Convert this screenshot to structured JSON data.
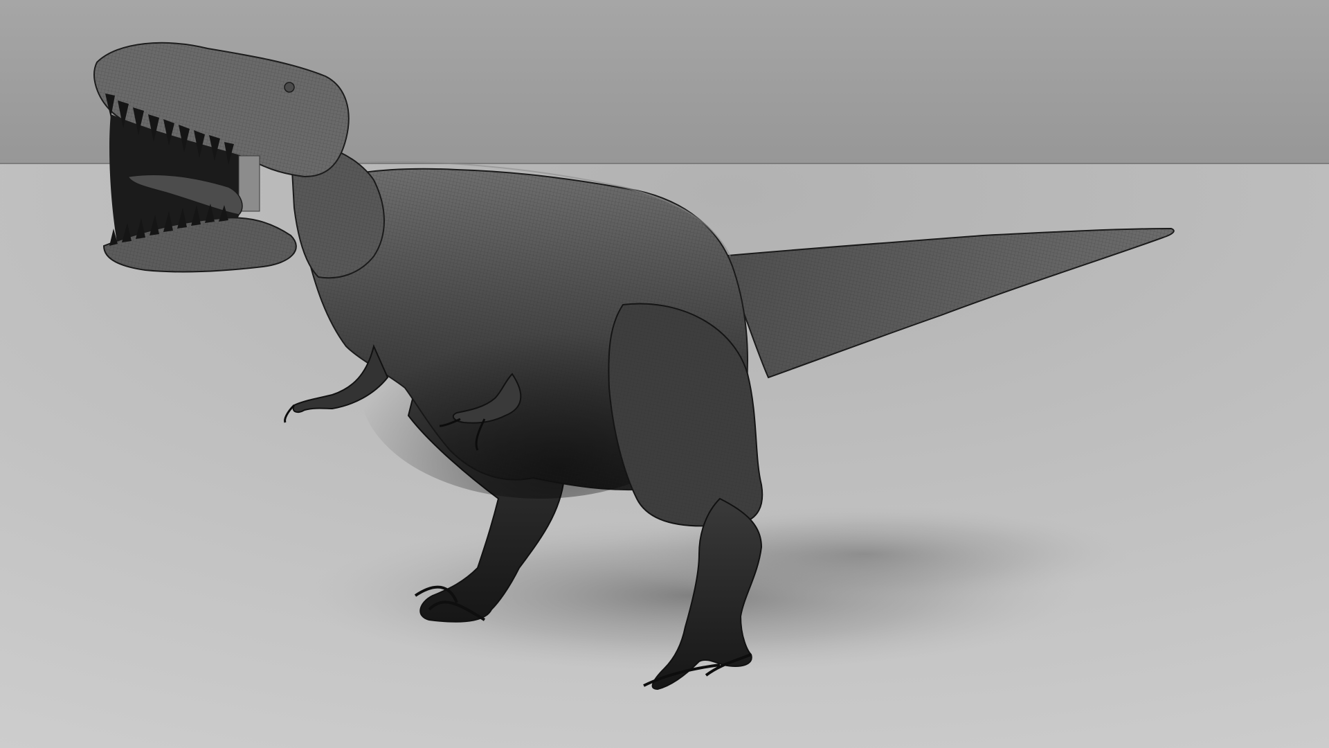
{
  "scene": {
    "subject": "t-rex-wireframe-render",
    "colors": {
      "backdrop_top": "#a2a2a2",
      "backdrop_bottom": "#9a9a9a",
      "floor_near": "#c9c9c9",
      "floor_far": "#b4b4b4",
      "horizon_line": "#7c7c7c",
      "body_light": "#6a6a6a",
      "body_dark": "#1e1e1e",
      "mesh_line": "#2b2b2b",
      "tongue": "#4a4a4a",
      "teeth": "#151515"
    }
  }
}
